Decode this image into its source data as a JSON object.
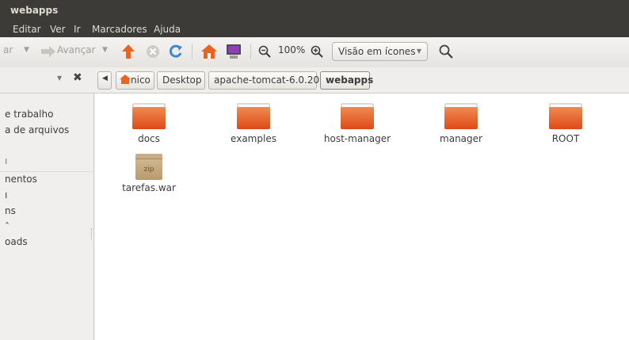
{
  "window": {
    "title": "webapps"
  },
  "menu": {
    "items": [
      "Editar",
      "Ver",
      "Ir",
      "Marcadores",
      "Ajuda"
    ]
  },
  "toolbar": {
    "back_partial": "ar",
    "forward_label": "Avançar",
    "zoom_level": "100%",
    "view_mode": "Visão em ícones"
  },
  "location": {
    "crumbs": [
      "nico",
      "Desktop",
      "apache-tomcat-6.0.20",
      "webapps"
    ]
  },
  "sidebar": {
    "items": [
      "e trabalho",
      "a de arquivos",
      "ı",
      "nentos",
      "ı",
      "ns",
      "ˆ",
      "oads"
    ]
  },
  "files": [
    {
      "name": "docs",
      "type": "folder"
    },
    {
      "name": "examples",
      "type": "folder"
    },
    {
      "name": "host-manager",
      "type": "folder"
    },
    {
      "name": "manager",
      "type": "folder"
    },
    {
      "name": "ROOT",
      "type": "folder"
    },
    {
      "name": "tarefas.war",
      "type": "zip",
      "badge": "zip"
    }
  ],
  "colors": {
    "accent": "#e5541e",
    "titlebar": "#3c3b37"
  }
}
